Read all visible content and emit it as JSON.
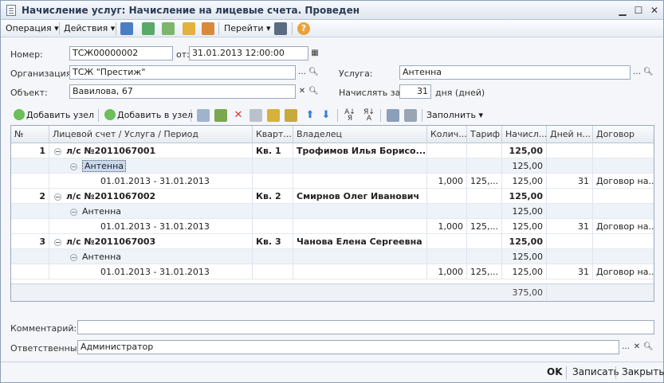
{
  "window": {
    "title": "Начисление услуг: Начисление на лицевые счета. Проведен"
  },
  "toolbar": {
    "operation": "Операция",
    "actions": "Действия",
    "goto": "Перейти"
  },
  "form": {
    "number_label": "Номер:",
    "number_value": "ТСЖ00000002",
    "date_label": "от:",
    "date_value": "31.01.2013 12:00:00",
    "org_label": "Организация:",
    "org_value": "ТСЖ \"Престиж\"",
    "service_label": "Услуга:",
    "service_value": "Антенна",
    "object_label": "Объект:",
    "object_value": "Вавилова, 67",
    "charge_label": "Начислять за:",
    "charge_value": "31",
    "charge_unit": "дня (дней)"
  },
  "grid_toolbar": {
    "add_node": "Добавить узел",
    "add_to_node": "Добавить в узел",
    "fill": "Заполнить"
  },
  "grid": {
    "headers": [
      "№",
      "Лицевой счет / Услуга / Период",
      "Кварт...",
      "Владелец",
      "Колич...",
      "Тариф",
      "Начисл...",
      "Дней н...",
      "Договор"
    ],
    "rows": [
      {
        "num": "1",
        "account": "л/с №2011067001",
        "apt": "Кв. 1",
        "owner": "Трофимов Илья Борисо...",
        "amount": "125,00"
      },
      {
        "service": "Антенна",
        "amount": "125,00"
      },
      {
        "period": "01.01.2013 - 31.01.2013",
        "qty": "1,000",
        "tariff": "125,...",
        "amount": "125,00",
        "days": "31",
        "contract": "Договор на..."
      },
      {
        "num": "2",
        "account": "л/с №2011067002",
        "apt": "Кв. 2",
        "owner": "Смирнов Олег Иванович",
        "amount": "125,00"
      },
      {
        "service": "Антенна",
        "amount": "125,00"
      },
      {
        "period": "01.01.2013 - 31.01.2013",
        "qty": "1,000",
        "tariff": "125,...",
        "amount": "125,00",
        "days": "31",
        "contract": "Договор на..."
      },
      {
        "num": "3",
        "account": "л/с №2011067003",
        "apt": "Кв. 3",
        "owner": "Чанова Елена Сергеевна",
        "amount": "125,00"
      },
      {
        "service": "Антенна",
        "amount": "125,00"
      },
      {
        "period": "01.01.2013 - 31.01.2013",
        "qty": "1,000",
        "tariff": "125,...",
        "amount": "125,00",
        "days": "31",
        "contract": "Договор на..."
      }
    ],
    "total": "375,00"
  },
  "comment_label": "Комментарий:",
  "comment_value": "",
  "responsible_label": "Ответственный:",
  "responsible_value": "Администратор",
  "buttons": {
    "ok": "OK",
    "save": "Записать",
    "close": "Закрыть"
  }
}
